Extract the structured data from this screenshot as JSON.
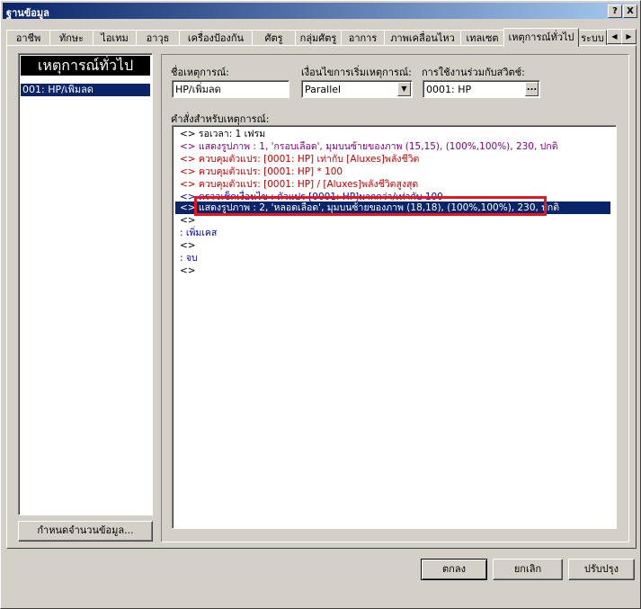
{
  "window": {
    "title": "ฐานข้อมูล",
    "help_label": "?",
    "close_label": "X"
  },
  "tabs": [
    {
      "label": "อาชีพ"
    },
    {
      "label": "ทักษะ"
    },
    {
      "label": "ไอเทม"
    },
    {
      "label": "อาวุธ"
    },
    {
      "label": "เครื่องป้องกัน"
    },
    {
      "label": "ศัตรู"
    },
    {
      "label": "กลุ่มศัตรู"
    },
    {
      "label": "อาการ"
    },
    {
      "label": "ภาพเคลื่อนไหว"
    },
    {
      "label": "เทลเซต"
    },
    {
      "label": "เหตุการณ์ทั่วไป"
    },
    {
      "label": "ระบบ"
    }
  ],
  "tab_scroll": {
    "left": "◀",
    "right": "▶"
  },
  "left_panel": {
    "header": "เหตุการณ์ทั่วไป",
    "items": [
      {
        "label": "001: HP/เพิ่มลด"
      }
    ],
    "set_count_button": "กำหนดจำนวนข้อมูล..."
  },
  "event_name": {
    "label": "ชื่อเหตุการณ์:",
    "value": "HP/เพิ่มลด"
  },
  "trigger": {
    "label": "เงื่อนไขการเริ่มเหตุการณ์:",
    "value": "Parallel",
    "arrow": "▼"
  },
  "switch": {
    "label": "การใช้งานร่วมกับสวิตช์:",
    "value": "0001: HP",
    "button": "..."
  },
  "commands": {
    "label": "คำสั่งสำหรับเหตุการณ์:",
    "lines": [
      {
        "text": "<> รอเวลา: 1 เฟรม",
        "color": "#000000"
      },
      {
        "text": "<> แสดงรูปภาพ : 1, 'กรอบเลือด', มุมบนซ้ายของภาพ (15,15), (100%,100%), 230, ปกติ",
        "color": "#800080"
      },
      {
        "text": "<> ควบคุมตัวแปร: [0001: HP] เท่ากับ [Aluxes]พลังชีวิต",
        "color": "#c00000"
      },
      {
        "text": "<> ควบคุมตัวแปร: [0001: HP] * 100",
        "color": "#c00000"
      },
      {
        "text": "<> ควบคุมตัวแปร: [0001: HP] / [Aluxes]พลังชีวิตสูงสุด",
        "color": "#c00000"
      },
      {
        "text": "<> ตรวจเช็คเงื่อนไข : ตัวแปร [0001: HP]มากกว่า/เท่ากับ 100",
        "color": "#0000c0"
      },
      {
        "text": "  <> แสดงรูปภาพ : 2, 'หลอดเลือด', มุมบนซ้ายของภาพ (18,18), (100%,100%), 230, ปกติ",
        "color": "#ffffff"
      },
      {
        "text": "  <>",
        "color": "#000000"
      },
      {
        "text": " :  เพิ่มเคส",
        "color": "#0000c0"
      },
      {
        "text": "  <>",
        "color": "#000000"
      },
      {
        "text": " :  จบ",
        "color": "#0000c0"
      },
      {
        "text": "<>",
        "color": "#000000"
      }
    ]
  },
  "footer": {
    "ok": "ตกลง",
    "cancel": "ยกเลิก",
    "apply": "ปรับปรุง"
  },
  "colors": {
    "highlight_box": "#e8141e",
    "selection": "#0a246a",
    "title_start": "#0a246a"
  }
}
